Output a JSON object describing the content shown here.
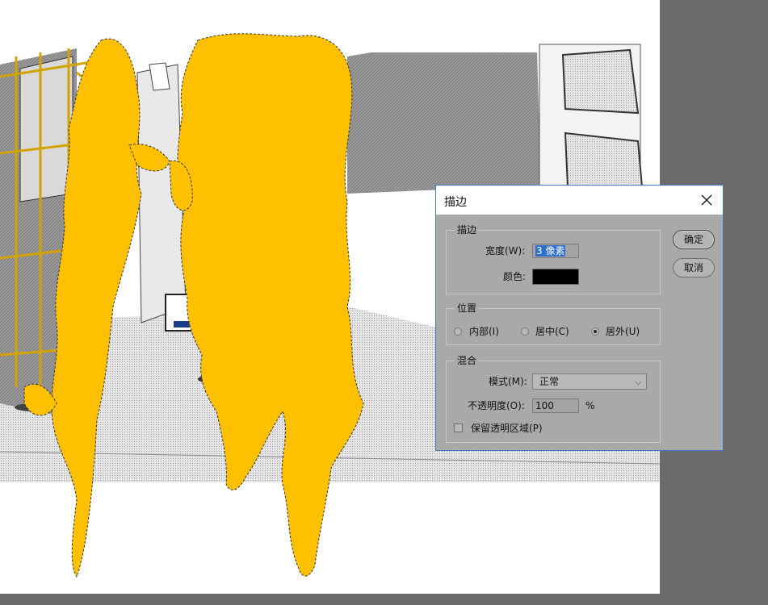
{
  "dialog": {
    "title": "描边",
    "ok_label": "确定",
    "cancel_label": "取消",
    "stroke": {
      "legend": "描边",
      "width_label": "宽度(W):",
      "width_value": "3 像素",
      "color_label": "颜色:",
      "color_value": "#000000"
    },
    "position": {
      "legend": "位置",
      "options": [
        {
          "label": "内部(I)",
          "selected": false
        },
        {
          "label": "居中(C)",
          "selected": false
        },
        {
          "label": "居外(U)",
          "selected": true
        }
      ]
    },
    "blend": {
      "legend": "混合",
      "mode_label": "模式(M):",
      "mode_value": "正常",
      "opacity_label": "不透明度(O):",
      "opacity_value": "100",
      "opacity_unit": "%",
      "preserve_label": "保留透明区域(P)",
      "preserve_checked": false
    }
  },
  "colors": {
    "accent": "#3f78c8",
    "foliage": "#ffc000",
    "dialog_bg": "#a9a9a9",
    "workspace": "#6b6b6b"
  },
  "icons": {
    "close": "close-icon",
    "dropdown": "chevron-down-icon"
  }
}
